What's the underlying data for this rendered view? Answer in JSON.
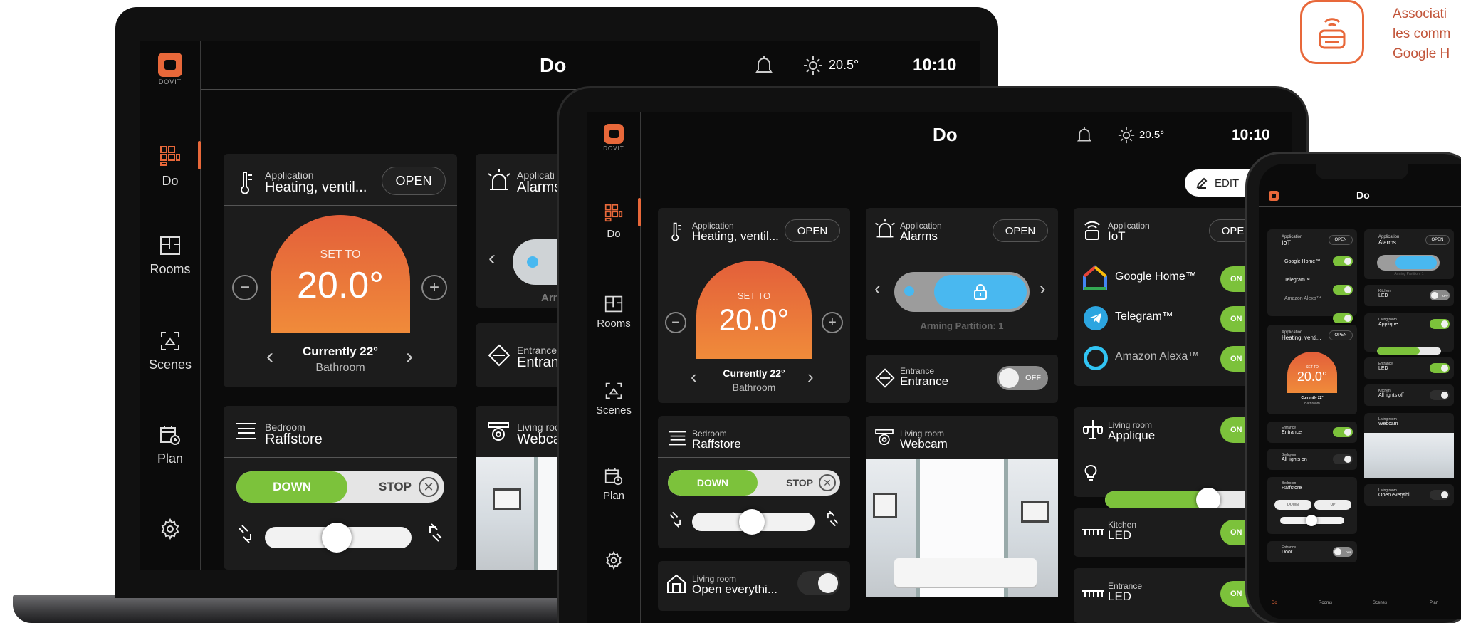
{
  "brand": {
    "icon": "router-icon",
    "text_lines": [
      "Associati",
      "les comm",
      "Google H"
    ],
    "accent": "#e8683a"
  },
  "app": {
    "logo_text": "DOVIT",
    "title": "Do",
    "temperature": "20.5°",
    "time": "10:10",
    "bell_icon": "bell-icon",
    "weather_icon": "sun-icon"
  },
  "nav": [
    {
      "label": "Do",
      "icon": "grid-icon",
      "active": true
    },
    {
      "label": "Rooms",
      "icon": "floorplan-icon"
    },
    {
      "label": "Scenes",
      "icon": "scene-icon"
    },
    {
      "label": "Plan",
      "icon": "calendar-clock-icon"
    },
    {
      "label": "",
      "icon": "gear-icon"
    }
  ],
  "edit_label": "EDIT",
  "widgets": {
    "heating": {
      "category": "Application",
      "title_laptop": "Heating, ventil...",
      "title_tablet": "Heating, ventil...",
      "open": "OPEN",
      "set_to": "SET TO",
      "value": "20.0°",
      "currently": "Currently 22°",
      "room": "Bathroom"
    },
    "alarms": {
      "category_laptop": "Applicati",
      "title_laptop": "Alarms",
      "category": "Application",
      "title": "Alarms",
      "open": "OPEN",
      "arming_laptop": "Armi",
      "arming": "Arming Partition: 1"
    },
    "iot": {
      "category": "Application",
      "title": "IoT",
      "open": "OPEN",
      "items": [
        {
          "label": "Google Home™",
          "state": "ON"
        },
        {
          "label": "Telegram™",
          "state": "ON"
        },
        {
          "label": "Amazon Alexa™",
          "state": "ON"
        }
      ]
    },
    "entrance_laptop": {
      "category": "Entrance",
      "title": "Entran"
    },
    "entrance": {
      "category": "Entrance",
      "title": "Entrance",
      "state": "OFF"
    },
    "raffstore": {
      "category": "Bedroom",
      "title": "Raffstore",
      "down": "DOWN",
      "stop": "STOP"
    },
    "webcam": {
      "category": "Living room",
      "title": "Webcam",
      "category_laptop": "Living roo",
      "title_laptop": "Webca"
    },
    "applique": {
      "category": "Living room",
      "title": "Applique",
      "state": "ON",
      "level": 0.68
    },
    "kitchen_led": {
      "category": "Kitchen",
      "title": "LED",
      "state": "ON"
    },
    "entrance_led": {
      "category": "Entrance",
      "title": "LED",
      "state": "ON"
    },
    "open_everything": {
      "category": "Living room",
      "title": "Open everythi..."
    },
    "raffstore_level": 0.5
  },
  "phone": {
    "title": "Do",
    "iot_category": "Application",
    "iot_title": "IoT",
    "open": "OPEN",
    "items": [
      "Google Home™",
      "Telegram™",
      "Amazon Alexa™"
    ],
    "alarms_category": "Application",
    "alarms_title": "Alarms",
    "arming": "Arming Partition: 1",
    "kitchen_led": {
      "category": "Kitchen",
      "title": "LED",
      "state": "OFF"
    },
    "heating": {
      "category": "Application",
      "title": "Heating, venti...",
      "set_to": "SET TO",
      "value": "20.0°",
      "currently": "Currently 22°",
      "room": "Bathroom"
    },
    "applique": {
      "category": "Living room",
      "title": "Applique"
    },
    "entrance_led": {
      "category": "Entrance",
      "title": "LED"
    },
    "kitchen_lights": {
      "category": "Kitchen",
      "title": "All lights off"
    },
    "entrance": {
      "category": "Entrance",
      "title": "Entrance"
    },
    "webcam": {
      "category": "Living room",
      "title": "Webcam"
    },
    "bedroom_lights": {
      "category": "Bedroom",
      "title": "All lights on"
    },
    "raffstore": {
      "category": "Bedroom",
      "title": "Raffstore",
      "down": "DOWN",
      "up": "UP"
    },
    "open_everything": {
      "category": "Living room",
      "title": "Open everythi..."
    },
    "door": {
      "category": "Entrance",
      "title": "Door",
      "state": "OFF"
    },
    "nav": [
      "Do",
      "Rooms",
      "Scenes",
      "Plan"
    ]
  }
}
